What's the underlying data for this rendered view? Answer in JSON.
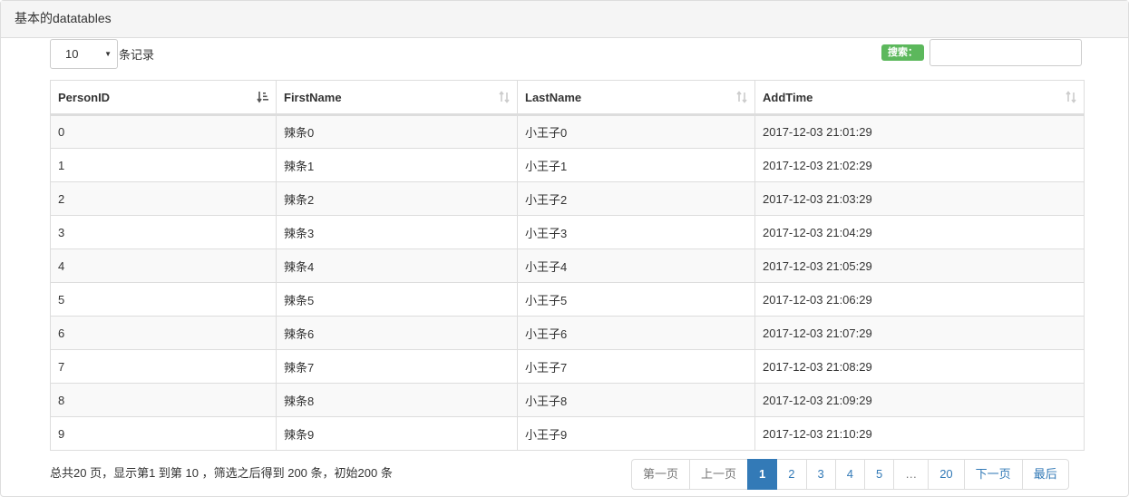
{
  "panel": {
    "title": "基本的datatables"
  },
  "length": {
    "value": "10",
    "label": "条记录"
  },
  "search": {
    "label": "搜索：",
    "value": ""
  },
  "table": {
    "columns": [
      "PersonID",
      "FirstName",
      "LastName",
      "AddTime"
    ],
    "rows": [
      [
        "0",
        "辣条0",
        "小王子0",
        "2017-12-03 21:01:29"
      ],
      [
        "1",
        "辣条1",
        "小王子1",
        "2017-12-03 21:02:29"
      ],
      [
        "2",
        "辣条2",
        "小王子2",
        "2017-12-03 21:03:29"
      ],
      [
        "3",
        "辣条3",
        "小王子3",
        "2017-12-03 21:04:29"
      ],
      [
        "4",
        "辣条4",
        "小王子4",
        "2017-12-03 21:05:29"
      ],
      [
        "5",
        "辣条5",
        "小王子5",
        "2017-12-03 21:06:29"
      ],
      [
        "6",
        "辣条6",
        "小王子6",
        "2017-12-03 21:07:29"
      ],
      [
        "7",
        "辣条7",
        "小王子7",
        "2017-12-03 21:08:29"
      ],
      [
        "8",
        "辣条8",
        "小王子8",
        "2017-12-03 21:09:29"
      ],
      [
        "9",
        "辣条9",
        "小王子9",
        "2017-12-03 21:10:29"
      ]
    ],
    "sorted_column": "PersonID",
    "sort_icon_active": "sort-amount-asc-icon",
    "sort_icon_inactive": "sort-both-icon"
  },
  "info": {
    "text": "总共20 页，显示第1 到第 10 ，筛选之后得到 200 条，初始200 条"
  },
  "pagination": {
    "first": "第一页",
    "prev": "上一页",
    "pages": [
      "1",
      "2",
      "3",
      "4",
      "5"
    ],
    "ellipsis": "…",
    "last_page": "20",
    "next": "下一页",
    "last": "最后",
    "current": "1"
  },
  "colors": {
    "accent": "#337ab7",
    "search_badge": "#5cb85c",
    "stripe": "#f9f9f9",
    "border": "#dddddd"
  }
}
